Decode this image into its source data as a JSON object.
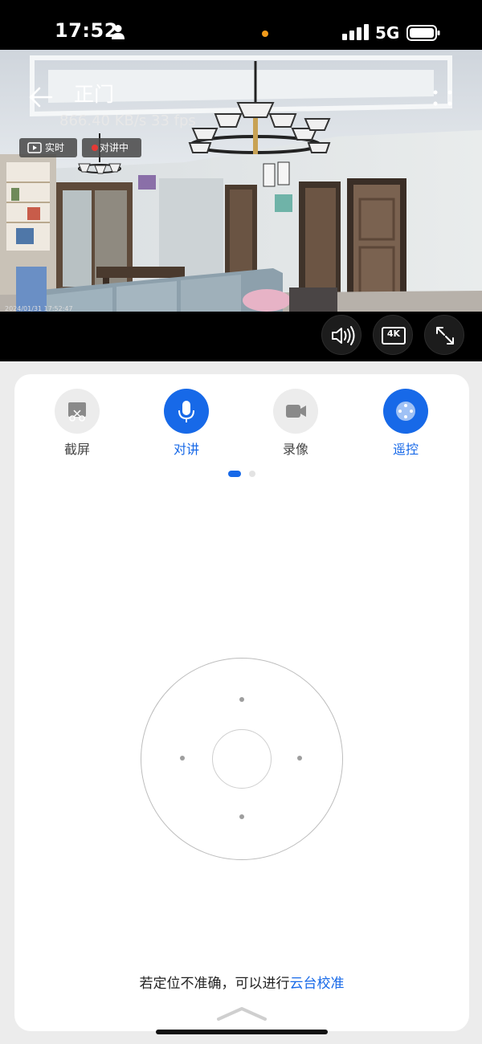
{
  "status_bar": {
    "time": "17:52",
    "network": "5G",
    "person_icon": "person-icon",
    "signal_icon": "cellular-signal-icon",
    "battery_icon": "battery-icon",
    "notification_dot_color": "#f29b1b"
  },
  "video": {
    "title": "正门",
    "stats": "866.40 KB/s   33 fps",
    "badges": {
      "live": "实时",
      "talking": "对讲中"
    },
    "timestamp": "2024/01/31 17:52:47",
    "controls": [
      "volume-icon",
      "4k-icon",
      "fullscreen-icon"
    ],
    "quality_label": "4K"
  },
  "actions": [
    {
      "label": "截屏",
      "icon": "screenshot-icon",
      "active": false
    },
    {
      "label": "对讲",
      "icon": "microphone-icon",
      "active": true
    },
    {
      "label": "录像",
      "icon": "video-camera-icon",
      "active": false
    },
    {
      "label": "遥控",
      "icon": "joystick-icon",
      "active": true
    }
  ],
  "pager": {
    "current_page": 1,
    "total_pages": 2
  },
  "hint": {
    "text": "若定位不准确，可以进行",
    "link": "云台校准"
  },
  "colors": {
    "accent": "#1769e8",
    "badge_dot": "#e53935"
  }
}
